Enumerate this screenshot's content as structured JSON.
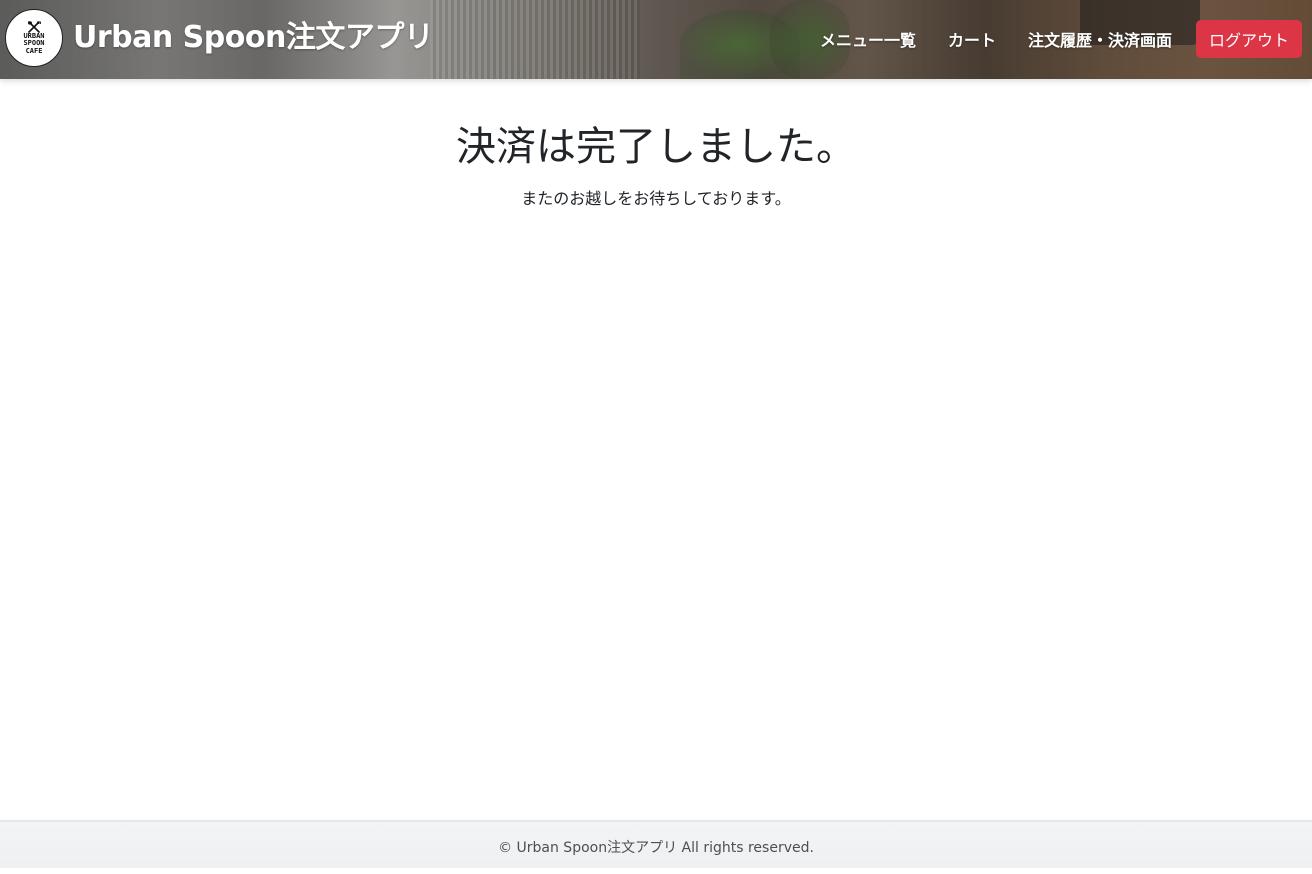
{
  "header": {
    "logo_text_line1": "URBAN",
    "logo_text_line2": "SPOON",
    "logo_text_line3": "CAFE",
    "title": "Urban Spoon注文アプリ",
    "nav": {
      "menu_list": "メニュー一覧",
      "cart": "カート",
      "order_history": "注文履歴・決済画面",
      "logout": "ログアウト"
    }
  },
  "main": {
    "heading": "決済は完了しました。",
    "message": "またのお越しをお待ちしております。"
  },
  "footer": {
    "copyright": "© Urban Spoon注文アプリ All rights reserved."
  },
  "colors": {
    "logout_button": "#dc3545",
    "text": "#212529"
  },
  "icons": {
    "logo": "fork-spoon-crossed-icon"
  }
}
